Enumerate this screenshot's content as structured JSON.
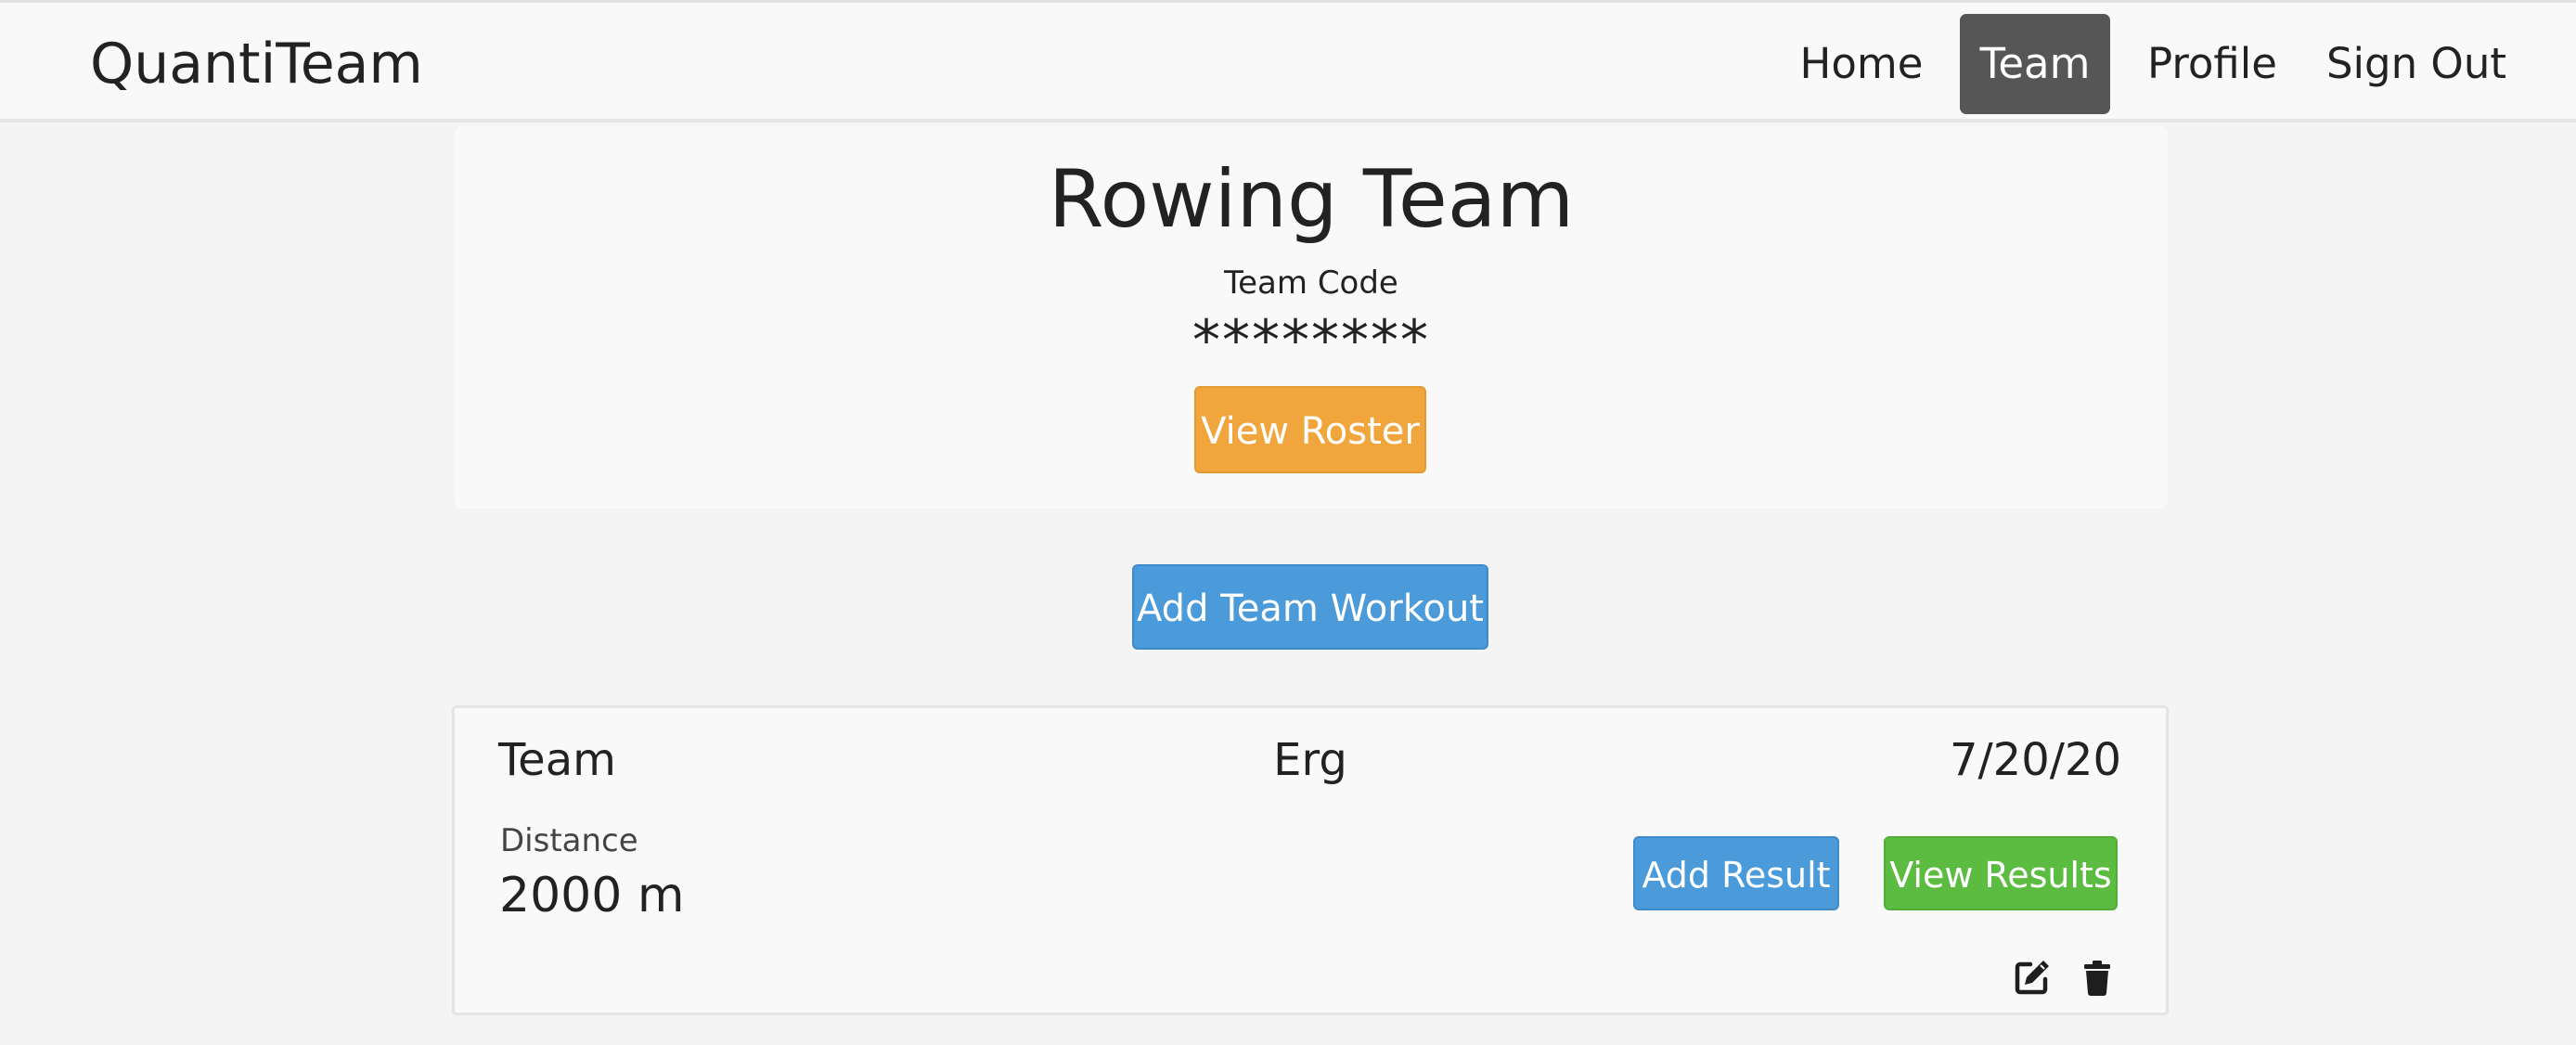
{
  "navbar": {
    "brand": "QuantiTeam",
    "links": [
      {
        "label": "Home",
        "active": false
      },
      {
        "label": "Team",
        "active": true
      },
      {
        "label": "Profile",
        "active": false
      },
      {
        "label": "Sign Out",
        "active": false
      }
    ]
  },
  "team": {
    "name": "Rowing Team",
    "code_label": "Team Code",
    "code_value": "********",
    "view_roster_label": "View Roster"
  },
  "actions": {
    "add_team_workout_label": "Add Team Workout"
  },
  "workouts": [
    {
      "type": "Team",
      "kind": "Erg",
      "date": "7/20/20",
      "metric_label": "Distance",
      "metric_value": "2000 m",
      "add_result_label": "Add Result",
      "view_results_label": "View Results",
      "icons": {
        "edit": "edit-icon",
        "delete": "trash-icon"
      }
    }
  ],
  "colors": {
    "nav_active_bg": "#565656",
    "roster_button": "#f0a63c",
    "primary_button": "#4b9ad9",
    "success_button": "#5cbc42",
    "page_bg": "#f4f4f4",
    "card_bg": "#f9f9f9"
  }
}
